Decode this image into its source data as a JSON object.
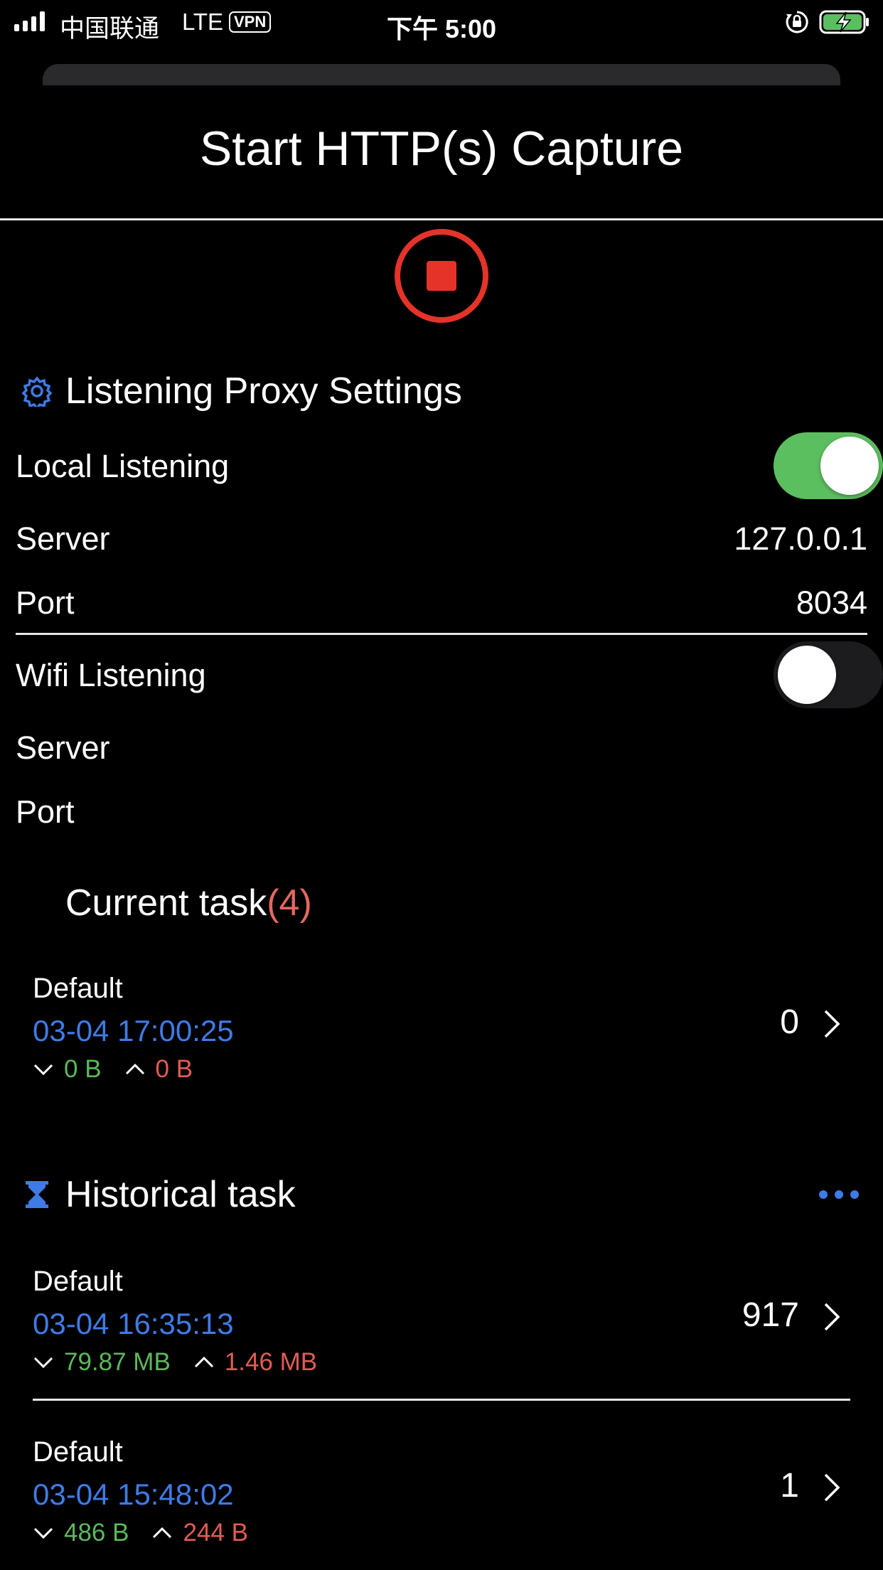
{
  "status_bar": {
    "carrier": "中国联通",
    "network": "LTE",
    "vpn": "VPN",
    "time": "下午 5:00"
  },
  "title": "Start HTTP(s) Capture",
  "proxy_section": {
    "title": "Listening Proxy Settings",
    "icon": "gear-icon",
    "local": {
      "label": "Local Listening",
      "enabled": true,
      "server_label": "Server",
      "server_value": "127.0.0.1",
      "port_label": "Port",
      "port_value": "8034"
    },
    "wifi": {
      "label": "Wifi Listening",
      "enabled": false,
      "server_label": "Server",
      "server_value": "",
      "port_label": "Port",
      "port_value": ""
    }
  },
  "current_section": {
    "title": "Current task",
    "count": "(4)",
    "tasks": [
      {
        "name": "Default",
        "time": "03-04 17:00:25",
        "down": "0 B",
        "up": "0 B",
        "count": "0"
      }
    ]
  },
  "history_section": {
    "title": "Historical task",
    "icon": "hourglass-icon",
    "tasks": [
      {
        "name": "Default",
        "time": "03-04 16:35:13",
        "down": "79.87 MB",
        "up": "1.46 MB",
        "count": "917"
      },
      {
        "name": "Default",
        "time": "03-04 15:48:02",
        "down": "486 B",
        "up": "244 B",
        "count": "1"
      }
    ]
  },
  "colors": {
    "accent_blue": "#3f7be6",
    "stop_red": "#e5332a",
    "toggle_green": "#5cbf5f",
    "download_green": "#5cb85c",
    "upload_red": "#e25c53"
  }
}
